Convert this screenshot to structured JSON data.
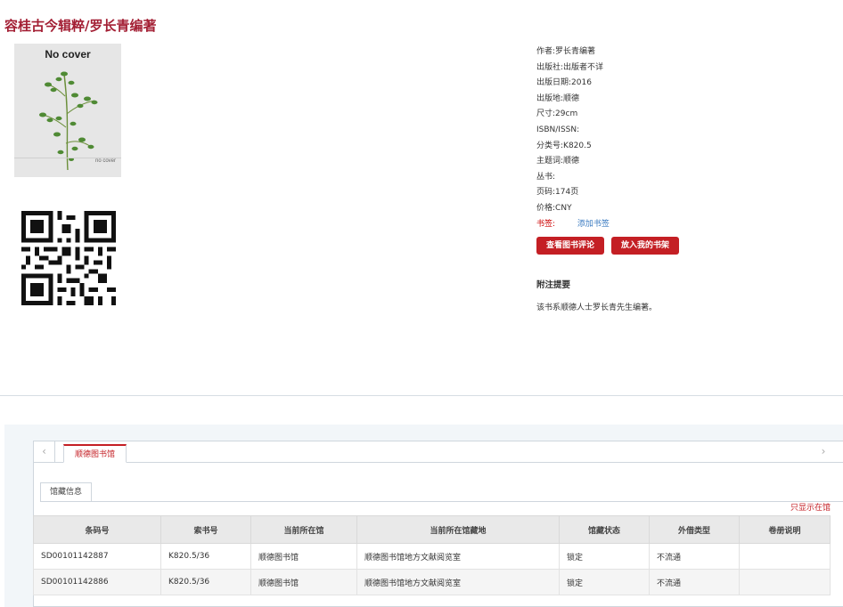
{
  "title": "容桂古今辑粹/罗长青编著",
  "cover": {
    "top_text": "No cover",
    "bottom_text": "no cover"
  },
  "meta": [
    {
      "label": "作者:",
      "value": "罗长青编著"
    },
    {
      "label": "出版社:",
      "value": "出版者不详"
    },
    {
      "label": "出版日期:",
      "value": "2016"
    },
    {
      "label": "出版地:",
      "value": "顺德"
    },
    {
      "label": "尺寸:",
      "value": "29cm"
    },
    {
      "label": "ISBN/ISSN:",
      "value": ""
    },
    {
      "label": "分类号:",
      "value": "K820.5"
    },
    {
      "label": "主题词:",
      "value": "顺德"
    },
    {
      "label": "丛书:",
      "value": ""
    },
    {
      "label": "页码:",
      "value": "174页"
    },
    {
      "label": "价格:",
      "value": "CNY"
    }
  ],
  "bookmark": {
    "label": "书签:",
    "link": "添加书签"
  },
  "buttons": {
    "review": "查看图书评论",
    "shelf": "放入我的书架"
  },
  "note": {
    "heading": "附注提要",
    "text": "该书系顺德人士罗长青先生编著。"
  },
  "holdings": {
    "library_tab": "顺德图书馆",
    "sub_tab": "馆藏信息",
    "only_show": "只显示在馆",
    "columns": [
      "条码号",
      "索书号",
      "当前所在馆",
      "当前所在馆藏地",
      "馆藏状态",
      "外借类型",
      "卷册说明"
    ],
    "rows": [
      [
        "SD00101142887",
        "K820.5/36",
        "顺德图书馆",
        "顺德图书馆地方文献阅览室",
        "锁定",
        "不流通",
        ""
      ],
      [
        "SD00101142886",
        "K820.5/36",
        "顺德图书馆",
        "顺德图书馆地方文献阅览室",
        "锁定",
        "不流通",
        ""
      ]
    ]
  },
  "icons": {
    "prev": "chevron-left-icon",
    "next": "chevron-right-icon",
    "qr": "qr-code-icon"
  },
  "colors": {
    "title": "#a31f34",
    "button": "#c41f24",
    "link": "#3a7ac0"
  }
}
